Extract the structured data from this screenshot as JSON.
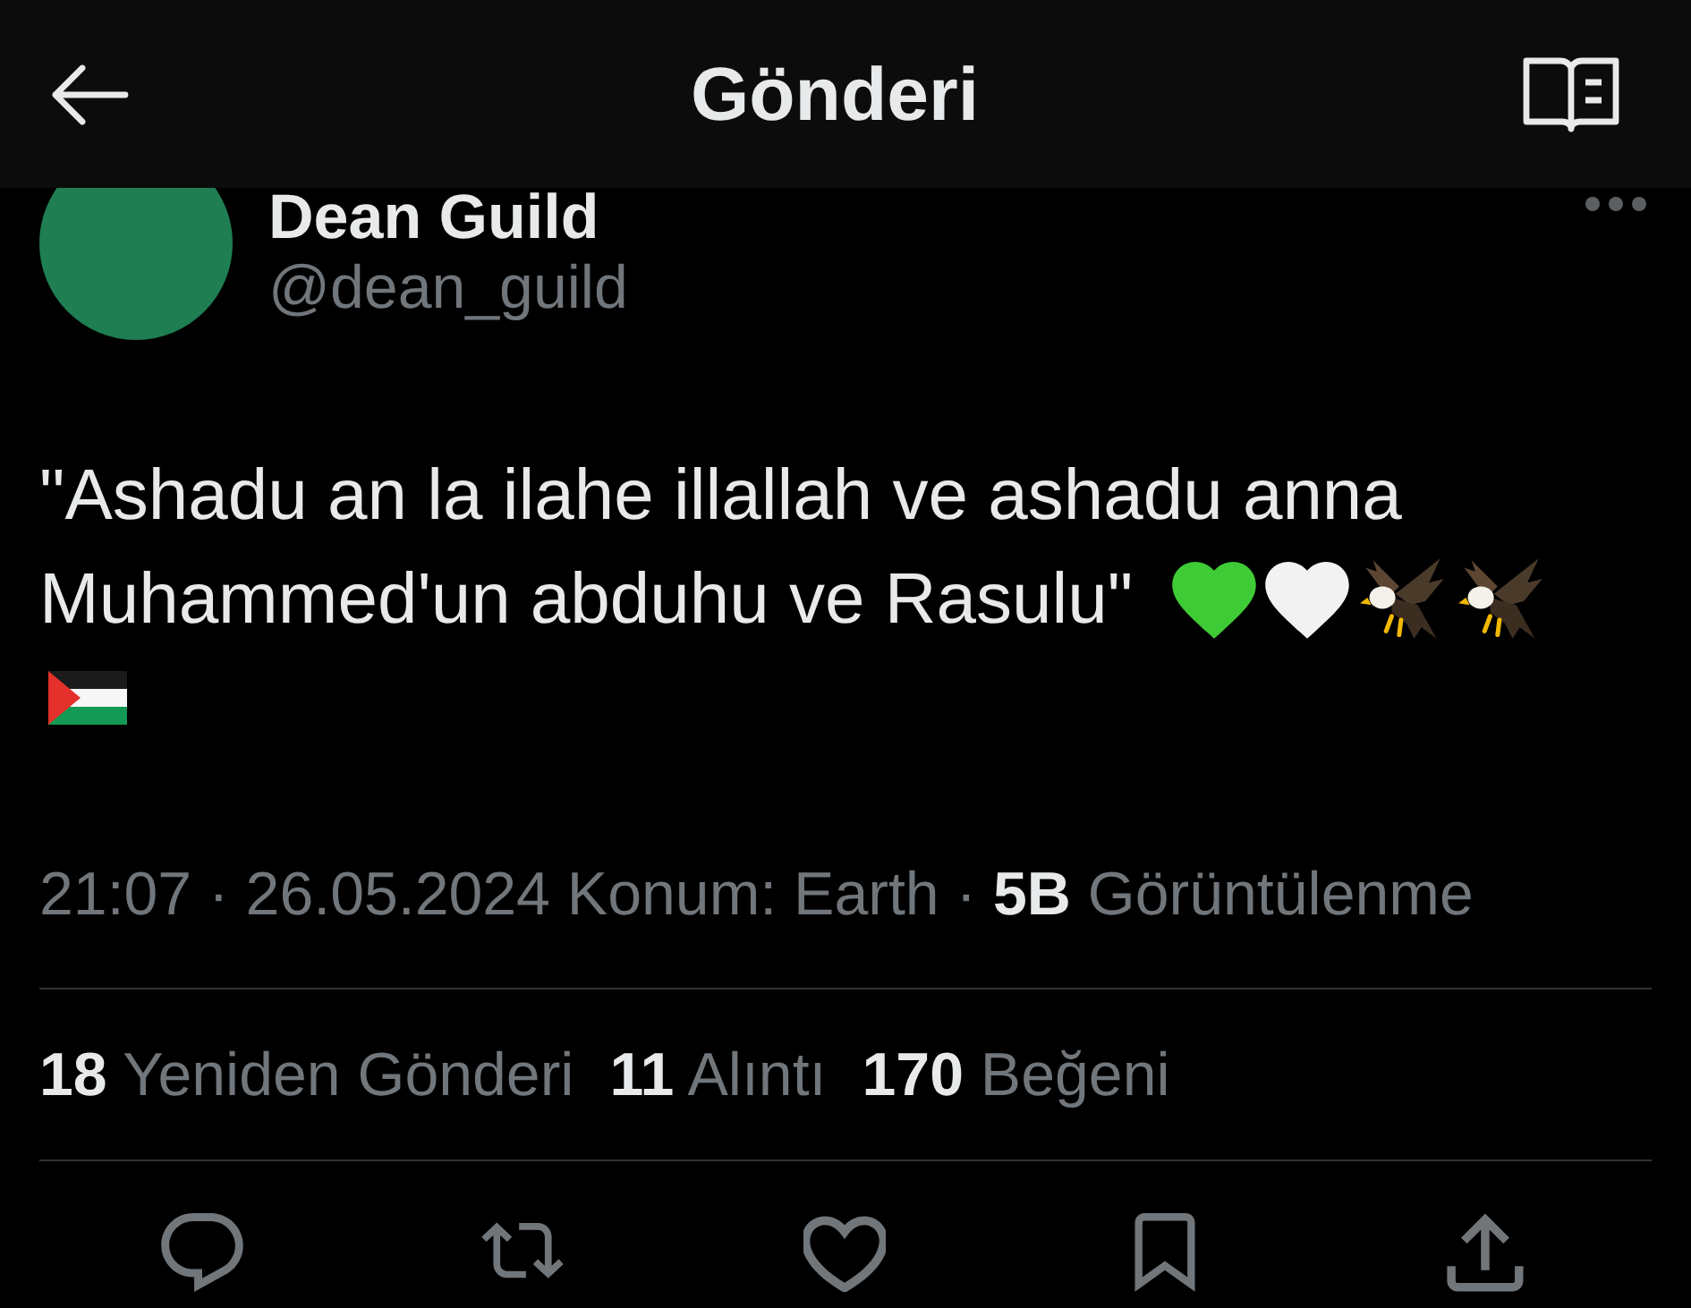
{
  "header": {
    "title": "Gönderi"
  },
  "author": {
    "name": "Dean Guild",
    "handle": "@dean_guild"
  },
  "tweet": {
    "text_lines": [
      "\"Ashadu an la ilahe illallah ve ashadu anna",
      "Muhammed'un abduhu ve Rasulu\""
    ]
  },
  "meta": "21:07 · 26.05.2024 Konum: Earth · **5B** Görüntülenme",
  "stats": [
    {
      "count": "18",
      "label": "Yeniden Gönderi"
    },
    {
      "count": "11",
      "label": "Alıntı"
    },
    {
      "count": "170",
      "label": "Beğeni"
    }
  ]
}
